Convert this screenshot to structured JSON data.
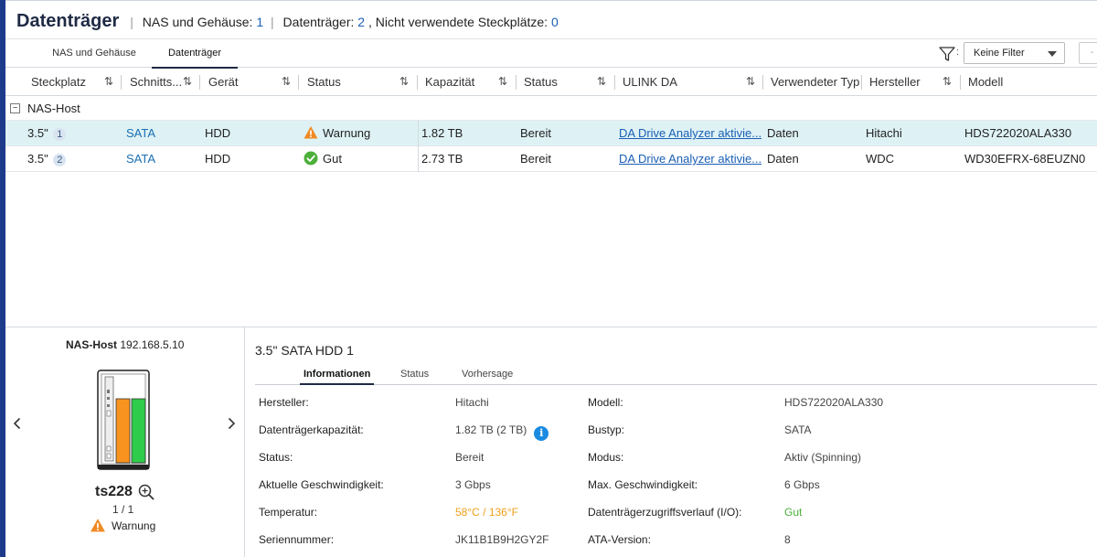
{
  "header": {
    "title": "Datenträger",
    "summary": {
      "nas_label": "NAS und Gehäuse:",
      "nas_count": "1",
      "disk_label": "Datenträger:",
      "disk_count": "2",
      "unused_label": ", Nicht verwendete Steckplätze:",
      "unused_count": "0"
    }
  },
  "tabs": [
    {
      "label": "NAS und Gehäuse"
    },
    {
      "label": "Datenträger",
      "active": true
    }
  ],
  "filter": {
    "selected": "Keine Filter",
    "colon": ":",
    "extra": "-",
    "icon": "filter-icon"
  },
  "table": {
    "columns": [
      "Steckplatz",
      "Schnitts...",
      "Gerät",
      "Status",
      "Kapazität",
      "Status",
      "ULINK DA",
      "Verwendeter Typ",
      "Hersteller",
      "Modell"
    ],
    "group": "NAS-Host",
    "rows": [
      {
        "slot": "3.5\"",
        "slot_num": "1",
        "interface": "SATA",
        "device": "HDD",
        "health": "Warnung",
        "health_icon": "warning-icon",
        "capacity": "1.82 TB",
        "state": "Bereit",
        "ulink": "DA Drive Analyzer aktivie...",
        "type": "Daten",
        "vendor": "Hitachi",
        "model": "HDS722020ALA330"
      },
      {
        "slot": "3.5\"",
        "slot_num": "2",
        "interface": "SATA",
        "device": "HDD",
        "health": "Gut",
        "health_icon": "check-icon",
        "capacity": "2.73 TB",
        "state": "Bereit",
        "ulink": "DA Drive Analyzer aktivie...",
        "type": "Daten",
        "vendor": "WDC",
        "model": "WD30EFRX-68EUZN0"
      }
    ]
  },
  "device": {
    "host_name": "NAS-Host",
    "host_ip": "192.168.5.10",
    "name": "ts228",
    "count": "1 / 1",
    "warning": "Warnung"
  },
  "detail": {
    "title": "3.5\" SATA HDD 1",
    "tabs": [
      "Informationen",
      "Status",
      "Vorhersage"
    ],
    "left": [
      {
        "label": "Hersteller:",
        "value": "Hitachi"
      },
      {
        "label": "Datenträgerkapazität:",
        "value": "1.82 TB (2 TB)"
      },
      {
        "label": "Status:",
        "value": "Bereit"
      },
      {
        "label": "Aktuelle Geschwindigkeit:",
        "value": "3 Gbps"
      },
      {
        "label": "Temperatur:",
        "value": "58°C / 136°F"
      },
      {
        "label": "Seriennummer:",
        "value": "JK11B1B9H2GY2F"
      }
    ],
    "right": [
      {
        "label": "Modell:",
        "value": "HDS722020ALA330"
      },
      {
        "label": "Bustyp:",
        "value": "SATA"
      },
      {
        "label": "Modus:",
        "value": "Aktiv (Spinning)"
      },
      {
        "label": "Max. Geschwindigkeit:",
        "value": "6 Gbps"
      },
      {
        "label": "Datenträgerzugriffsverlauf (I/O):",
        "value": "Gut"
      },
      {
        "label": "ATA-Version:",
        "value": "8"
      }
    ],
    "info_icon": "i",
    "colors": {
      "temperature": "#f0a01c",
      "io_history": "#4caf3a"
    }
  },
  "colors": {
    "accent": "#1e3a8a",
    "selected_row": "#def2f5",
    "link": "#1a5fb4"
  }
}
